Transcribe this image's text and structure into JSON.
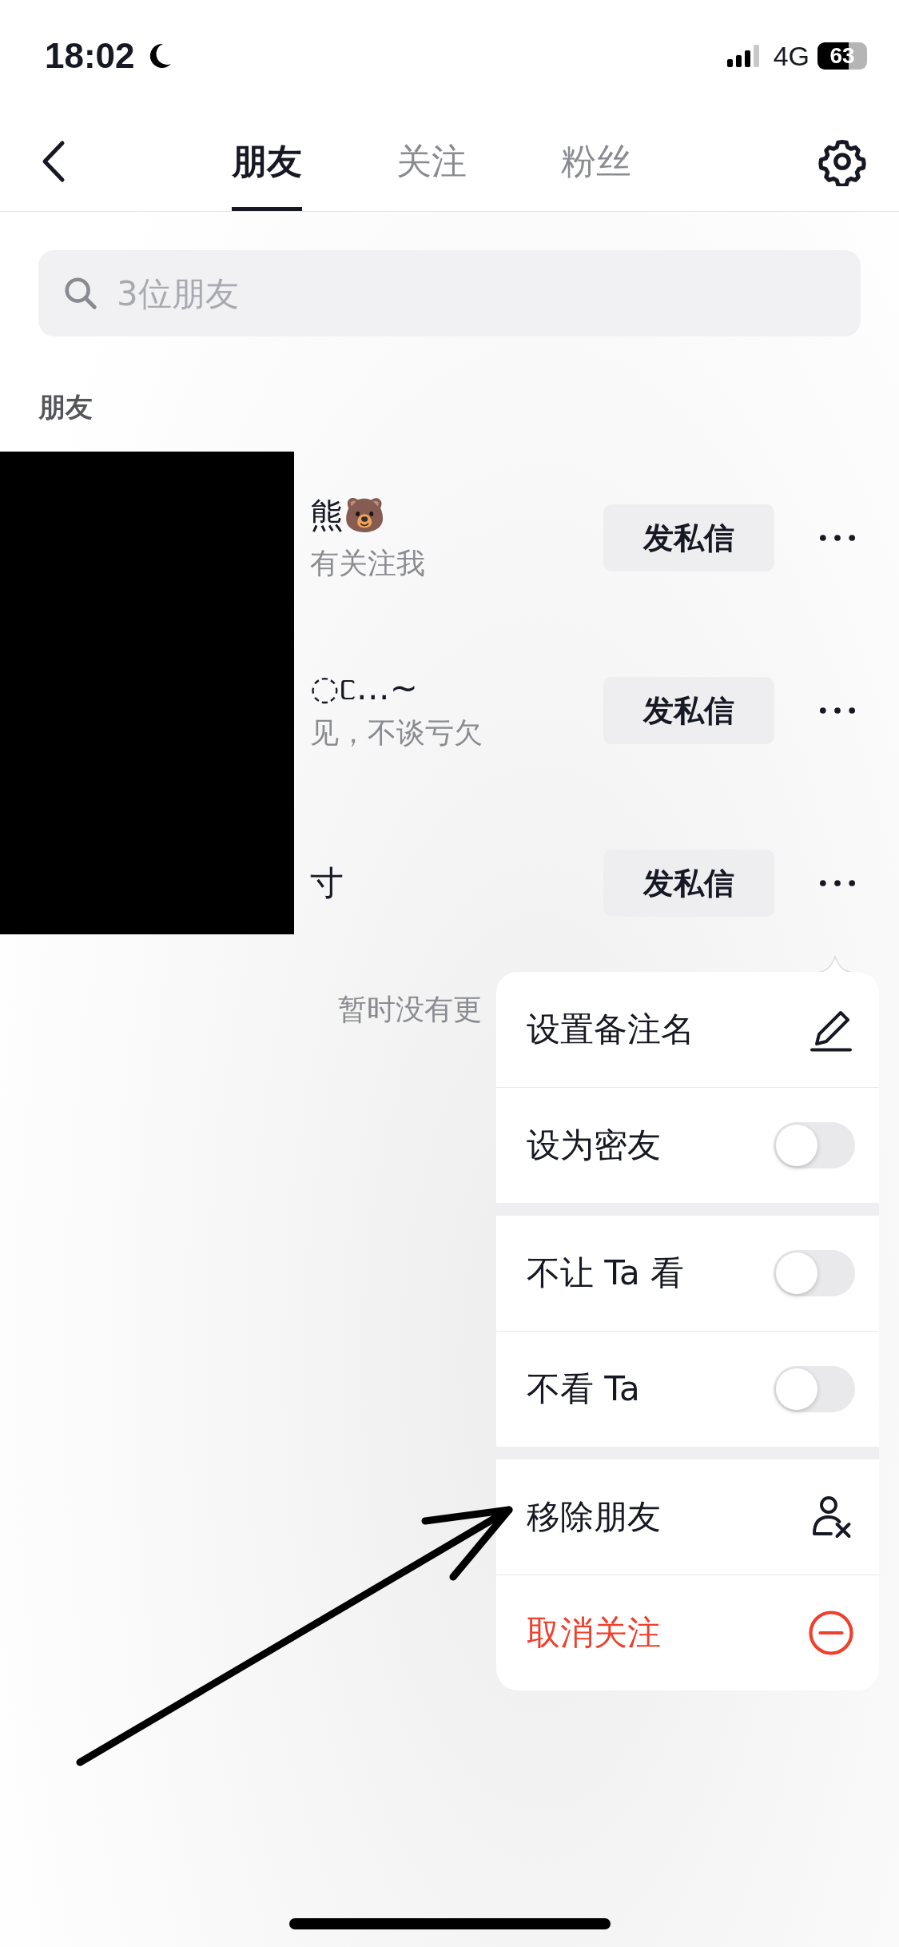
{
  "status_bar": {
    "time": "18:02",
    "network": "4G",
    "battery": "63"
  },
  "tabs": [
    {
      "label": "朋友",
      "selected": true
    },
    {
      "label": "关注",
      "selected": false
    },
    {
      "label": "粉丝",
      "selected": false
    }
  ],
  "search": {
    "placeholder": "3位朋友"
  },
  "section_title": "朋友",
  "friends": [
    {
      "name": "熊🐻",
      "subtitle": "有关注我",
      "button": "发私信"
    },
    {
      "name": "◌ᥴ…~",
      "subtitle": "见，不谈亏欠",
      "button": "发私信"
    },
    {
      "name": "寸",
      "button": "发私信"
    }
  ],
  "empty_hint": "暂时没有更",
  "menu": {
    "groups": [
      [
        {
          "kind": "edit",
          "label": "设置备注名"
        },
        {
          "kind": "toggle",
          "label": "设为密友",
          "on": false
        }
      ],
      [
        {
          "kind": "toggle",
          "label": "不让 Ta 看",
          "on": false
        },
        {
          "kind": "toggle",
          "label": "不看 Ta",
          "on": false
        }
      ],
      [
        {
          "kind": "remove",
          "label": "移除朋友"
        },
        {
          "kind": "unfollow",
          "label": "取消关注"
        }
      ]
    ]
  }
}
